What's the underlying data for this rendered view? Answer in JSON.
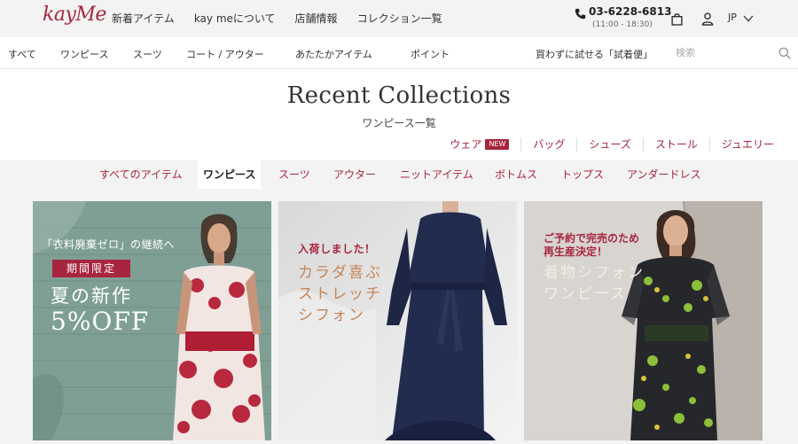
{
  "header": {
    "logo": "kayMe",
    "nav": [
      "新着アイテム",
      "kay meについて",
      "店舗情報",
      "コレクション一覧"
    ],
    "phone": "03-6228-6813",
    "hours": "(11:00 - 18:30)",
    "lang": "JP"
  },
  "subnav": {
    "items": [
      "すべて",
      "ワンピース",
      "スーツ",
      "コート / アウター",
      "あたたかアイテム",
      "ポイント",
      "買わずに試せる「試着便」"
    ],
    "search_placeholder": "検索"
  },
  "title": "Recent Collections",
  "subtitle": "ワンピース一覧",
  "categories": [
    "ウェア",
    "バッグ",
    "シューズ",
    "ストール",
    "ジュエリー"
  ],
  "new_badge": "NEW",
  "tabs": [
    "すべてのアイテム",
    "ワンピース",
    "スーツ",
    "アウター",
    "ニットアイテム",
    "ボトムス",
    "トップス",
    "アンダードレス"
  ],
  "active_tab": "ワンピース",
  "cards": [
    {
      "line1": "「衣料廃棄ゼロ」の継続へ",
      "badge": "期間限定",
      "line2": "夏の新作",
      "line3": "5%OFF"
    },
    {
      "line1": "入荷しました！",
      "line2": "カラダ喜ぶ",
      "line3": "ストレッチ",
      "line4": "シフォン"
    },
    {
      "line1": "ご予約で完売のため",
      "line2": "再生産決定！",
      "line3": "着物シフォン",
      "line4": "ワンピース"
    }
  ],
  "colors": {
    "brand": "#a8253f",
    "band": "#f3f3f3"
  }
}
